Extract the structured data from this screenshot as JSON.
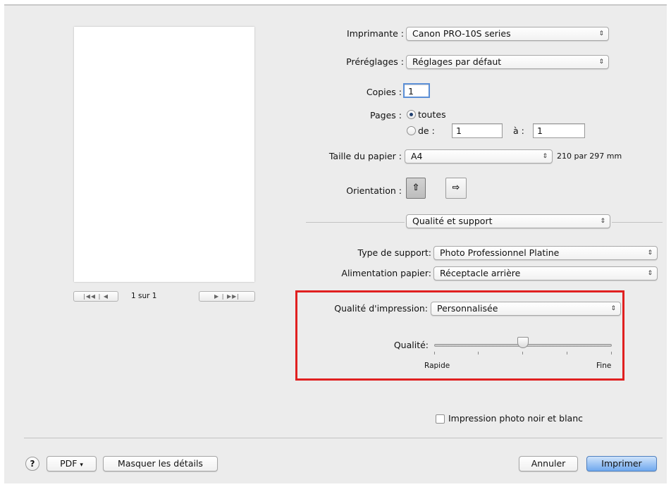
{
  "printer": {
    "label": "Imprimante :",
    "value": "Canon PRO-10S series"
  },
  "presets": {
    "label": "Préréglages :",
    "value": "Réglages par défaut"
  },
  "copies": {
    "label": "Copies :",
    "value": "1"
  },
  "pages": {
    "label": "Pages :",
    "all_label": "toutes",
    "range_label": "de :",
    "from_value": "1",
    "to_label": "à :",
    "to_value": "1",
    "selected": "toutes"
  },
  "paper_size": {
    "label": "Taille du papier :",
    "value": "A4",
    "dimensions": "210 par 297 mm"
  },
  "orientation": {
    "label": "Orientation :",
    "portrait_icon": "portrait-orientation-icon",
    "landscape_icon": "landscape-orientation-icon",
    "selected": "portrait"
  },
  "section": {
    "value": "Qualité et support"
  },
  "media_type": {
    "label": "Type de support:",
    "value": "Photo Professionnel Platine"
  },
  "paper_source": {
    "label": "Alimentation papier:",
    "value": "Réceptacle arrière"
  },
  "print_quality": {
    "label": "Qualité d'impression:",
    "value": "Personnalisée",
    "highlight_color": "#e02020"
  },
  "quality_slider": {
    "label": "Qualité:",
    "min_label": "Rapide",
    "max_label": "Fine",
    "steps": 5,
    "position": 3
  },
  "grayscale": {
    "label": "Impression photo noir et blanc",
    "checked": false
  },
  "preview": {
    "page_indicator": "1 sur 1"
  },
  "footer": {
    "help": "?",
    "pdf_label": "PDF",
    "hide_details": "Masquer les détails",
    "cancel": "Annuler",
    "print": "Imprimer"
  }
}
